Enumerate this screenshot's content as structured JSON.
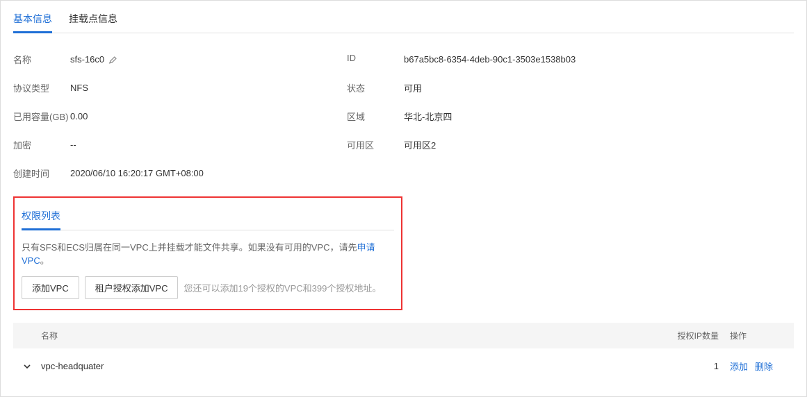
{
  "tabs": {
    "basic_info": "基本信息",
    "mount_info": "挂载点信息"
  },
  "details": {
    "name_label": "名称",
    "name_value": "sfs-16c0",
    "protocol_label": "协议类型",
    "protocol_value": "NFS",
    "used_label": "已用容量(GB)",
    "used_value": "0.00",
    "encrypt_label": "加密",
    "encrypt_value": "--",
    "created_label": "创建时间",
    "created_value": "2020/06/10 16:20:17 GMT+08:00",
    "id_label": "ID",
    "id_value": "b67a5bc8-6354-4deb-90c1-3503e1538b03",
    "status_label": "状态",
    "status_value": "可用",
    "region_label": "区域",
    "region_value": "华北-北京四",
    "az_label": "可用区",
    "az_value": "可用区2"
  },
  "perm": {
    "title": "权限列表",
    "hint_prefix": "只有SFS和ECS归属在同一VPC上并挂载才能文件共享。如果没有可用的VPC，请先",
    "hint_link": "申请VPC",
    "hint_suffix": "。",
    "add_vpc_btn": "添加VPC",
    "tenant_btn": "租户授权添加VPC",
    "quota_text": "您还可以添加19个授权的VPC和399个授权地址。",
    "table": {
      "col_name": "名称",
      "col_ipcount": "授权IP数量",
      "col_ops": "操作",
      "rows": [
        {
          "name": "vpc-headquater",
          "ipcount": "1"
        }
      ],
      "op_add": "添加",
      "op_delete": "删除"
    }
  }
}
